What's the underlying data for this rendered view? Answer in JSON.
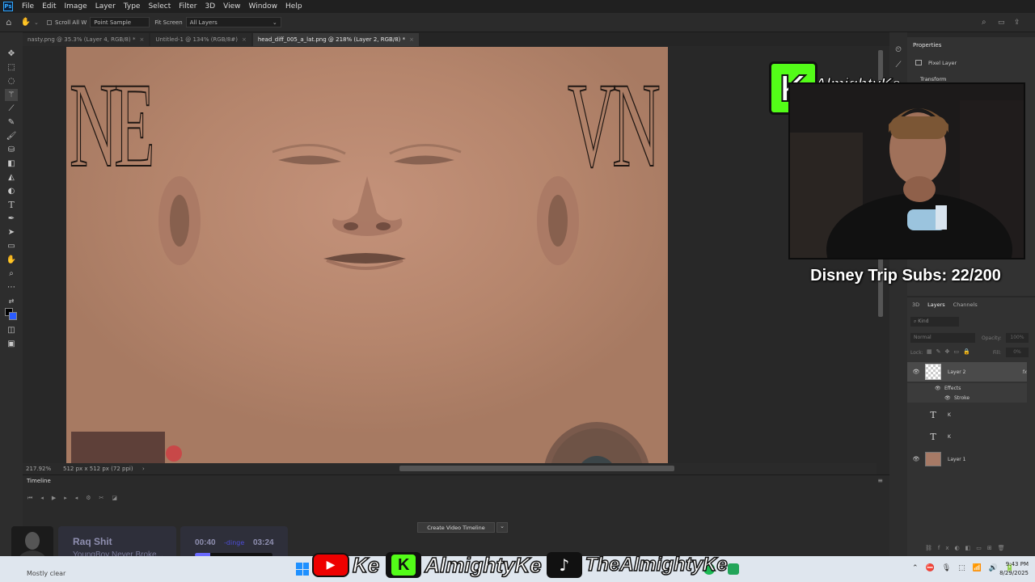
{
  "app": {
    "menu": [
      "File",
      "Edit",
      "Image",
      "Layer",
      "Type",
      "Select",
      "Filter",
      "3D",
      "View",
      "Window",
      "Help"
    ],
    "logo_text": "Ps"
  },
  "options": {
    "scroll_all": "Scroll All W",
    "sample": "Point Sample",
    "fit_screen": "Fit Screen",
    "all_layers": "All Layers"
  },
  "tabs": [
    {
      "label": "nasty.png @ 35.3% (Layer 4, RGB/8) *",
      "active": false
    },
    {
      "label": "Untitled-1 @ 134% (RGB/8#)",
      "active": false
    },
    {
      "label": "head_diff_005_a_lat.png @ 218% (Layer 2, RGB/8) *",
      "active": true
    }
  ],
  "status": {
    "zoom": "217.92%",
    "doc_size": "512 px x 512 px (72 ppi)"
  },
  "canvas": {
    "left_text": "NE",
    "right_text": "VN"
  },
  "timeline": {
    "title": "Timeline",
    "create_button": "Create Video Timeline"
  },
  "properties": {
    "title": "Properties",
    "kind": "Pixel Layer",
    "section": "Transform"
  },
  "layers": {
    "tabs": [
      "3D",
      "Layers",
      "Channels"
    ],
    "search_placeholder": "Kind",
    "blend": "Normal",
    "opacity_label": "Opacity:",
    "opacity_value": "100%",
    "lock_label": "Lock:",
    "fill_label": "Fill:",
    "fill_value": "0%",
    "items": [
      {
        "name": "Layer 2",
        "fx": "fx"
      },
      {
        "name": "Effects"
      },
      {
        "name": "Stroke"
      },
      {
        "name": "K"
      },
      {
        "name": "K"
      },
      {
        "name": "Layer 1"
      }
    ]
  },
  "overlay": {
    "brand": "AlmightyKe",
    "subs_text": "Disney Trip Subs: 22/200",
    "socials": [
      "Ke",
      "AlmightyKe",
      "TheAlmightyKe"
    ]
  },
  "music": {
    "title": "Raq Shit",
    "artist": "YoungBoy Never Broke...",
    "elapsed": "00:40",
    "total": "03:24",
    "progress": 0.2,
    "badge": "-dinge",
    "weather": "Mostly clear"
  },
  "clock": {
    "time": "9:43 PM",
    "date": "8/29/2025"
  },
  "colors": {
    "accent": "#31a8ff",
    "skin": "#b7876c",
    "kick_green": "#53fc18"
  }
}
